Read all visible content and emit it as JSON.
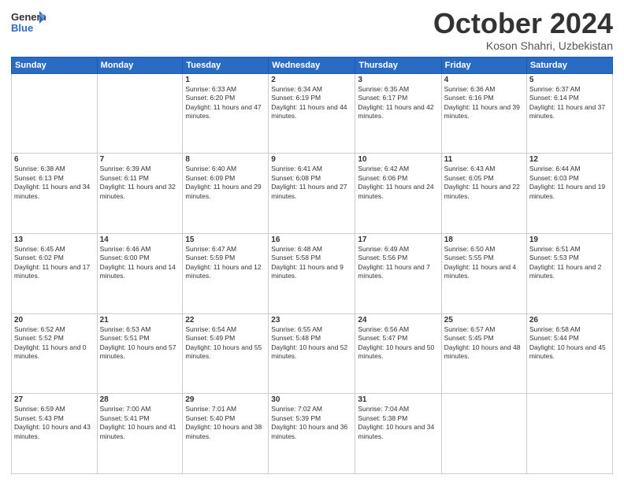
{
  "header": {
    "logo_general": "General",
    "logo_blue": "Blue",
    "month": "October 2024",
    "location": "Koson Shahri, Uzbekistan"
  },
  "days_of_week": [
    "Sunday",
    "Monday",
    "Tuesday",
    "Wednesday",
    "Thursday",
    "Friday",
    "Saturday"
  ],
  "weeks": [
    [
      {
        "num": "",
        "sunrise": "",
        "sunset": "",
        "daylight": ""
      },
      {
        "num": "",
        "sunrise": "",
        "sunset": "",
        "daylight": ""
      },
      {
        "num": "1",
        "sunrise": "Sunrise: 6:33 AM",
        "sunset": "Sunset: 6:20 PM",
        "daylight": "Daylight: 11 hours and 47 minutes."
      },
      {
        "num": "2",
        "sunrise": "Sunrise: 6:34 AM",
        "sunset": "Sunset: 6:19 PM",
        "daylight": "Daylight: 11 hours and 44 minutes."
      },
      {
        "num": "3",
        "sunrise": "Sunrise: 6:35 AM",
        "sunset": "Sunset: 6:17 PM",
        "daylight": "Daylight: 11 hours and 42 minutes."
      },
      {
        "num": "4",
        "sunrise": "Sunrise: 6:36 AM",
        "sunset": "Sunset: 6:16 PM",
        "daylight": "Daylight: 11 hours and 39 minutes."
      },
      {
        "num": "5",
        "sunrise": "Sunrise: 6:37 AM",
        "sunset": "Sunset: 6:14 PM",
        "daylight": "Daylight: 11 hours and 37 minutes."
      }
    ],
    [
      {
        "num": "6",
        "sunrise": "Sunrise: 6:38 AM",
        "sunset": "Sunset: 6:13 PM",
        "daylight": "Daylight: 11 hours and 34 minutes."
      },
      {
        "num": "7",
        "sunrise": "Sunrise: 6:39 AM",
        "sunset": "Sunset: 6:11 PM",
        "daylight": "Daylight: 11 hours and 32 minutes."
      },
      {
        "num": "8",
        "sunrise": "Sunrise: 6:40 AM",
        "sunset": "Sunset: 6:09 PM",
        "daylight": "Daylight: 11 hours and 29 minutes."
      },
      {
        "num": "9",
        "sunrise": "Sunrise: 6:41 AM",
        "sunset": "Sunset: 6:08 PM",
        "daylight": "Daylight: 11 hours and 27 minutes."
      },
      {
        "num": "10",
        "sunrise": "Sunrise: 6:42 AM",
        "sunset": "Sunset: 6:06 PM",
        "daylight": "Daylight: 11 hours and 24 minutes."
      },
      {
        "num": "11",
        "sunrise": "Sunrise: 6:43 AM",
        "sunset": "Sunset: 6:05 PM",
        "daylight": "Daylight: 11 hours and 22 minutes."
      },
      {
        "num": "12",
        "sunrise": "Sunrise: 6:44 AM",
        "sunset": "Sunset: 6:03 PM",
        "daylight": "Daylight: 11 hours and 19 minutes."
      }
    ],
    [
      {
        "num": "13",
        "sunrise": "Sunrise: 6:45 AM",
        "sunset": "Sunset: 6:02 PM",
        "daylight": "Daylight: 11 hours and 17 minutes."
      },
      {
        "num": "14",
        "sunrise": "Sunrise: 6:46 AM",
        "sunset": "Sunset: 6:00 PM",
        "daylight": "Daylight: 11 hours and 14 minutes."
      },
      {
        "num": "15",
        "sunrise": "Sunrise: 6:47 AM",
        "sunset": "Sunset: 5:59 PM",
        "daylight": "Daylight: 11 hours and 12 minutes."
      },
      {
        "num": "16",
        "sunrise": "Sunrise: 6:48 AM",
        "sunset": "Sunset: 5:58 PM",
        "daylight": "Daylight: 11 hours and 9 minutes."
      },
      {
        "num": "17",
        "sunrise": "Sunrise: 6:49 AM",
        "sunset": "Sunset: 5:56 PM",
        "daylight": "Daylight: 11 hours and 7 minutes."
      },
      {
        "num": "18",
        "sunrise": "Sunrise: 6:50 AM",
        "sunset": "Sunset: 5:55 PM",
        "daylight": "Daylight: 11 hours and 4 minutes."
      },
      {
        "num": "19",
        "sunrise": "Sunrise: 6:51 AM",
        "sunset": "Sunset: 5:53 PM",
        "daylight": "Daylight: 11 hours and 2 minutes."
      }
    ],
    [
      {
        "num": "20",
        "sunrise": "Sunrise: 6:52 AM",
        "sunset": "Sunset: 5:52 PM",
        "daylight": "Daylight: 11 hours and 0 minutes."
      },
      {
        "num": "21",
        "sunrise": "Sunrise: 6:53 AM",
        "sunset": "Sunset: 5:51 PM",
        "daylight": "Daylight: 10 hours and 57 minutes."
      },
      {
        "num": "22",
        "sunrise": "Sunrise: 6:54 AM",
        "sunset": "Sunset: 5:49 PM",
        "daylight": "Daylight: 10 hours and 55 minutes."
      },
      {
        "num": "23",
        "sunrise": "Sunrise: 6:55 AM",
        "sunset": "Sunset: 5:48 PM",
        "daylight": "Daylight: 10 hours and 52 minutes."
      },
      {
        "num": "24",
        "sunrise": "Sunrise: 6:56 AM",
        "sunset": "Sunset: 5:47 PM",
        "daylight": "Daylight: 10 hours and 50 minutes."
      },
      {
        "num": "25",
        "sunrise": "Sunrise: 6:57 AM",
        "sunset": "Sunset: 5:45 PM",
        "daylight": "Daylight: 10 hours and 48 minutes."
      },
      {
        "num": "26",
        "sunrise": "Sunrise: 6:58 AM",
        "sunset": "Sunset: 5:44 PM",
        "daylight": "Daylight: 10 hours and 45 minutes."
      }
    ],
    [
      {
        "num": "27",
        "sunrise": "Sunrise: 6:59 AM",
        "sunset": "Sunset: 5:43 PM",
        "daylight": "Daylight: 10 hours and 43 minutes."
      },
      {
        "num": "28",
        "sunrise": "Sunrise: 7:00 AM",
        "sunset": "Sunset: 5:41 PM",
        "daylight": "Daylight: 10 hours and 41 minutes."
      },
      {
        "num": "29",
        "sunrise": "Sunrise: 7:01 AM",
        "sunset": "Sunset: 5:40 PM",
        "daylight": "Daylight: 10 hours and 38 minutes."
      },
      {
        "num": "30",
        "sunrise": "Sunrise: 7:02 AM",
        "sunset": "Sunset: 5:39 PM",
        "daylight": "Daylight: 10 hours and 36 minutes."
      },
      {
        "num": "31",
        "sunrise": "Sunrise: 7:04 AM",
        "sunset": "Sunset: 5:38 PM",
        "daylight": "Daylight: 10 hours and 34 minutes."
      },
      {
        "num": "",
        "sunrise": "",
        "sunset": "",
        "daylight": ""
      },
      {
        "num": "",
        "sunrise": "",
        "sunset": "",
        "daylight": ""
      }
    ]
  ]
}
